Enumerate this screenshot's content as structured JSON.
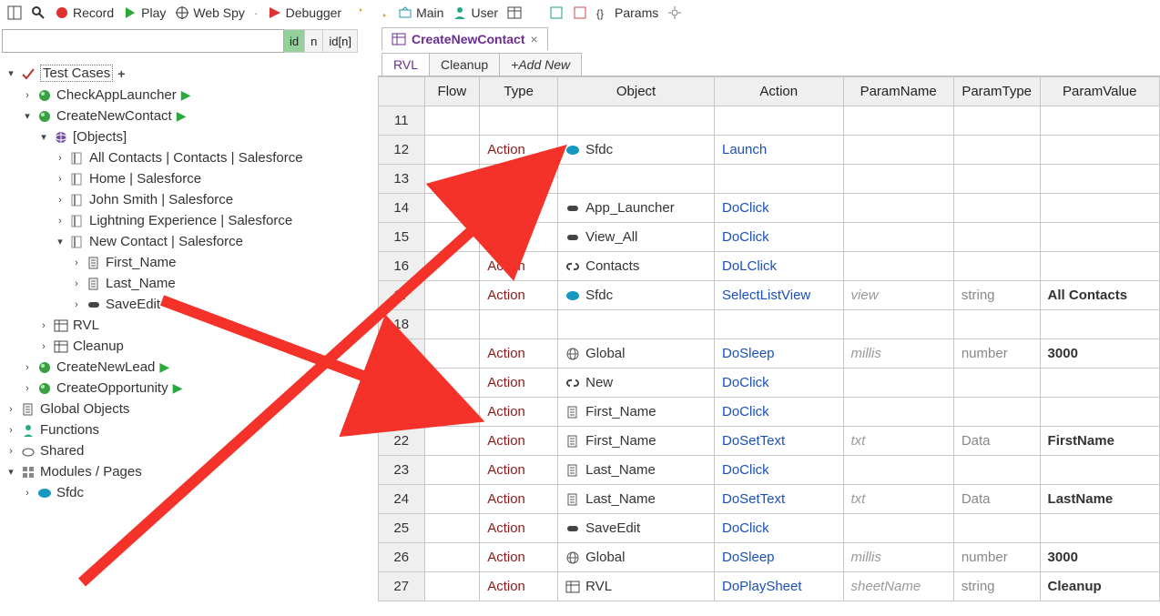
{
  "toolbar": {
    "record": "Record",
    "play": "Play",
    "webspy": "Web Spy",
    "debugger": "Debugger",
    "main": "Main",
    "user": "User",
    "params": "Params"
  },
  "filter": {
    "placeholder": "",
    "id": "id",
    "n": "n",
    "idn": "id[n]"
  },
  "tree": [
    {
      "indent": 0,
      "arrow": "v",
      "icon": "check",
      "label": "Test Cases",
      "selected": true,
      "extra": "plus"
    },
    {
      "indent": 1,
      "arrow": ">",
      "icon": "green-ball",
      "label": "CheckAppLauncher",
      "play": true
    },
    {
      "indent": 1,
      "arrow": "v",
      "icon": "green-ball",
      "label": "CreateNewContact",
      "play": true
    },
    {
      "indent": 2,
      "arrow": "v",
      "icon": "globe",
      "label": "[Objects]"
    },
    {
      "indent": 3,
      "arrow": ">",
      "icon": "page",
      "label": "All Contacts | Contacts | Salesforce"
    },
    {
      "indent": 3,
      "arrow": ">",
      "icon": "page",
      "label": "Home | Salesforce"
    },
    {
      "indent": 3,
      "arrow": ">",
      "icon": "page",
      "label": "John Smith | Salesforce"
    },
    {
      "indent": 3,
      "arrow": ">",
      "icon": "page",
      "label": "Lightning Experience | Salesforce"
    },
    {
      "indent": 3,
      "arrow": "v",
      "icon": "page",
      "label": "New Contact | Salesforce"
    },
    {
      "indent": 4,
      "arrow": ">",
      "icon": "doc",
      "label": "First_Name"
    },
    {
      "indent": 4,
      "arrow": ">",
      "icon": "doc",
      "label": "Last_Name"
    },
    {
      "indent": 4,
      "arrow": ">",
      "icon": "button",
      "label": "SaveEdit"
    },
    {
      "indent": 2,
      "arrow": ">",
      "icon": "grid",
      "label": "RVL"
    },
    {
      "indent": 2,
      "arrow": ">",
      "icon": "grid",
      "label": "Cleanup"
    },
    {
      "indent": 1,
      "arrow": ">",
      "icon": "green-ball",
      "label": "CreateNewLead",
      "play": true
    },
    {
      "indent": 1,
      "arrow": ">",
      "icon": "green-ball",
      "label": "CreateOpportunity",
      "play": true
    },
    {
      "indent": 0,
      "arrow": ">",
      "icon": "doc",
      "label": "Global Objects"
    },
    {
      "indent": 0,
      "arrow": ">",
      "icon": "fn",
      "label": "Functions"
    },
    {
      "indent": 0,
      "arrow": ">",
      "icon": "cloud",
      "label": "Shared"
    },
    {
      "indent": 0,
      "arrow": "v",
      "icon": "module",
      "label": "Modules / Pages"
    },
    {
      "indent": 1,
      "arrow": ">",
      "icon": "sfdc",
      "label": "Sfdc"
    }
  ],
  "tab": {
    "title": "CreateNewContact",
    "close": "×"
  },
  "subtabs": {
    "rvl": "RVL",
    "cleanup": "Cleanup",
    "addnew": "+Add New"
  },
  "columns": {
    "row": "",
    "flow": "Flow",
    "type": "Type",
    "object": "Object",
    "action": "Action",
    "pname": "ParamName",
    "ptype": "ParamType",
    "pval": "ParamValue"
  },
  "rows": [
    {
      "n": "11"
    },
    {
      "n": "12",
      "type": "Action",
      "oicon": "sfdc",
      "object": "Sfdc",
      "action": "Launch"
    },
    {
      "n": "13"
    },
    {
      "n": "14",
      "type": "Action",
      "oicon": "button",
      "object": "App_Launcher",
      "action": "DoClick"
    },
    {
      "n": "15",
      "type": "Action",
      "oicon": "button",
      "object": "View_All",
      "action": "DoClick"
    },
    {
      "n": "16",
      "type": "Action",
      "oicon": "link",
      "object": "Contacts",
      "action": "DoLClick"
    },
    {
      "n": "17",
      "type": "Action",
      "oicon": "sfdc",
      "object": "Sfdc",
      "action": "SelectListView",
      "pname": "view",
      "ptype": "string",
      "pval": "All Contacts"
    },
    {
      "n": "18"
    },
    {
      "n": "19",
      "type": "Action",
      "oicon": "globe2",
      "object": "Global",
      "action": "DoSleep",
      "pname": "millis",
      "ptype": "number",
      "pval": "3000"
    },
    {
      "n": "20",
      "type": "Action",
      "oicon": "link",
      "object": "New",
      "action": "DoClick"
    },
    {
      "n": "21",
      "type": "Action",
      "oicon": "doc",
      "object": "First_Name",
      "action": "DoClick"
    },
    {
      "n": "22",
      "type": "Action",
      "oicon": "doc",
      "object": "First_Name",
      "action": "DoSetText",
      "pname": "txt",
      "ptype": "Data",
      "pval": "FirstName"
    },
    {
      "n": "23",
      "type": "Action",
      "oicon": "doc",
      "object": "Last_Name",
      "action": "DoClick"
    },
    {
      "n": "24",
      "type": "Action",
      "oicon": "doc",
      "object": "Last_Name",
      "action": "DoSetText",
      "pname": "txt",
      "ptype": "Data",
      "pval": "LastName"
    },
    {
      "n": "25",
      "type": "Action",
      "oicon": "button",
      "object": "SaveEdit",
      "action": "DoClick"
    },
    {
      "n": "26",
      "type": "Action",
      "oicon": "globe2",
      "object": "Global",
      "action": "DoSleep",
      "pname": "millis",
      "ptype": "number",
      "pval": "3000"
    },
    {
      "n": "27",
      "type": "Action",
      "oicon": "grid",
      "object": "RVL",
      "action": "DoPlaySheet",
      "pname": "sheetName",
      "ptype": "string",
      "pval": "Cleanup"
    }
  ]
}
